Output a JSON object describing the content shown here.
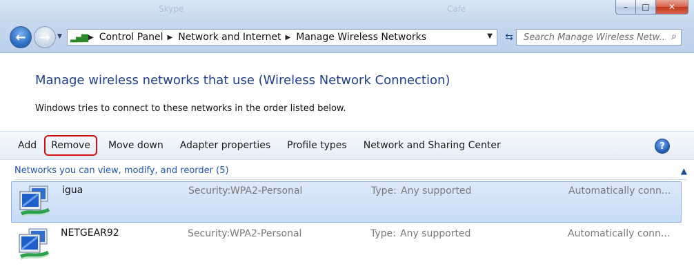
{
  "window": {
    "ghost_title_left": "Skype",
    "ghost_title_right": "Cafe",
    "minimize_glyph": "–",
    "maximize_glyph": "□",
    "close_glyph": "✕"
  },
  "nav": {
    "back_glyph": "←",
    "forward_glyph": "→",
    "history_glyph": "▼",
    "breadcrumbs": [
      "Control Panel",
      "Network and Internet",
      "Manage Wireless Networks"
    ],
    "crumb_separator": "▶",
    "address_dropdown_glyph": "▼",
    "refresh_glyph": "⇆",
    "search_placeholder": "Search Manage Wireless Netw...",
    "search_glyph": "⌕"
  },
  "page": {
    "heading": "Manage wireless networks that use (Wireless Network Connection)",
    "subtext": "Windows tries to connect to these networks in the order listed below."
  },
  "toolbar": {
    "items": [
      "Add",
      "Remove",
      "Move down",
      "Adapter properties",
      "Profile types",
      "Network and Sharing Center"
    ],
    "highlighted": "Remove",
    "help_glyph": "?"
  },
  "group": {
    "title": "Networks you can view, modify, and reorder (5)",
    "collapse_glyph": "▲"
  },
  "networks": [
    {
      "name": "igua",
      "security_label": "Security:",
      "security_value": "WPA2-Personal",
      "type_label": "Type:",
      "type_value": "Any supported",
      "connection": "Automatically conn...",
      "selected": true
    },
    {
      "name": "NETGEAR92",
      "security_label": "Security:",
      "security_value": "WPA2-Personal",
      "type_label": "Type:",
      "type_value": "Any supported",
      "connection": "Automatically conn...",
      "selected": false
    }
  ],
  "colors": {
    "heading": "#1e3f8a",
    "group_title": "#1f55b3",
    "highlight_outline": "#d01010",
    "selection_fill": "#c7dcf6"
  },
  "icons": {
    "back": "back-arrow-icon",
    "forward": "forward-arrow-icon",
    "address": "wireless-signal-icon",
    "refresh": "refresh-icon",
    "search": "search-icon",
    "help": "help-icon",
    "network": "wireless-network-computer-icon"
  }
}
